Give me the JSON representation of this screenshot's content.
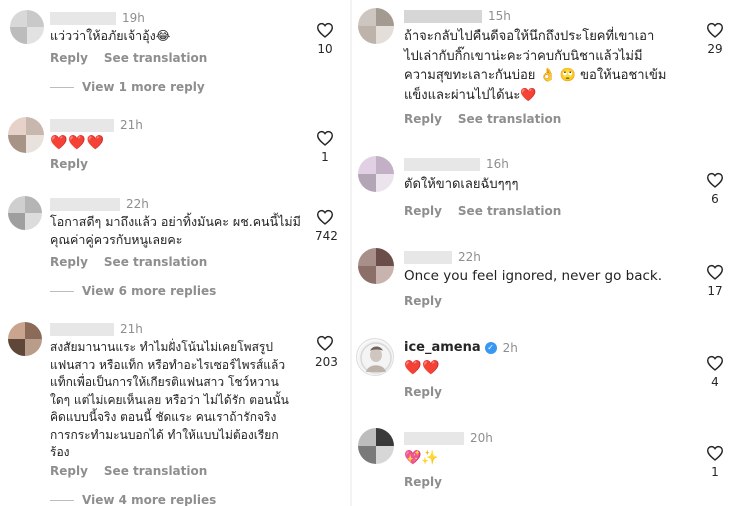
{
  "left": {
    "comments": [
      {
        "time": "19h",
        "text": "แว่วว่าให้อภัยเจ้าอุ้ง😂",
        "likes": "10",
        "reply": "Reply",
        "translate": "See translation",
        "view_more": "View 1 more reply"
      },
      {
        "time": "21h",
        "text": "❤️❤️❤️",
        "likes": "1",
        "reply": "Reply"
      },
      {
        "time": "22h",
        "text": "โอกาสดีๆ มาถึงแล้ว อย่าทิ้งมันคะ ผช.คนนี้ไม่มี\nคุณค่าคู่ควรกับหนูเลยคะ",
        "likes": "742",
        "reply": "Reply",
        "translate": "See translation",
        "view_more": "View 6 more replies"
      },
      {
        "time": "21h",
        "text": "สงสัยมานานแระ ทำไมฝั่งโน้นไม่เคยโพสรูป\nแฟนสาว หรือแท็ก หรือทำอะไรเซอร์ไพรส์แล้ว\nแท็กเพื่อเป็นการให้เกียรติแฟนสาว โชว์หวาน\nใดๆ แต่ไม่เคยเห็นเลย หรือว่า ไม่ได้รัก ตอนนั้น\nคิดแบบนี้จริง ตอนนี้ ชัดแระ คนเราถ้ารักจริง\nการกระทำมะนบอกได้ ทำให้แบบไม่ต้องเรียก\nร้อง",
        "likes": "203",
        "reply": "Reply",
        "translate": "See translation",
        "view_more": "View 4 more replies"
      }
    ]
  },
  "right": {
    "comments": [
      {
        "time": "15h",
        "text": "ถ้าจะกลับไปคืนดีจอให้นึกถึงประโยคที่เขาเอา\nไปเล่ากับกิ๊กเขาน่ะคะว่าคบกับนิชาแล้วไม่มี\nความสุขทะเลาะกันบ่อย 👌 🙄 ขอให้นอชาเข้ม\nแข็งและผ่านไปได้นะ❤️",
        "likes": "29",
        "reply": "Reply",
        "translate": "See translation"
      },
      {
        "time": "16h",
        "text": "ตัดให้ขาดเลยฉับๆๆๆ",
        "likes": "6",
        "reply": "Reply",
        "translate": "See translation"
      },
      {
        "time": "22h",
        "text": "Once you feel ignored, never go back.",
        "likes": "17",
        "reply": "Reply"
      },
      {
        "username": "ice_amena",
        "time": "2h",
        "text": "❤️❤️",
        "likes": "4",
        "reply": "Reply"
      },
      {
        "time": "20h",
        "text": "💖✨",
        "likes": "1",
        "reply": "Reply"
      }
    ]
  },
  "colors": {
    "meta": "#8e8e8e",
    "text": "#262626",
    "verified": "#3897f0",
    "heart": "#e0262c"
  },
  "icons": {
    "like": "heart-outline-icon",
    "verified": "verified-badge-icon"
  }
}
